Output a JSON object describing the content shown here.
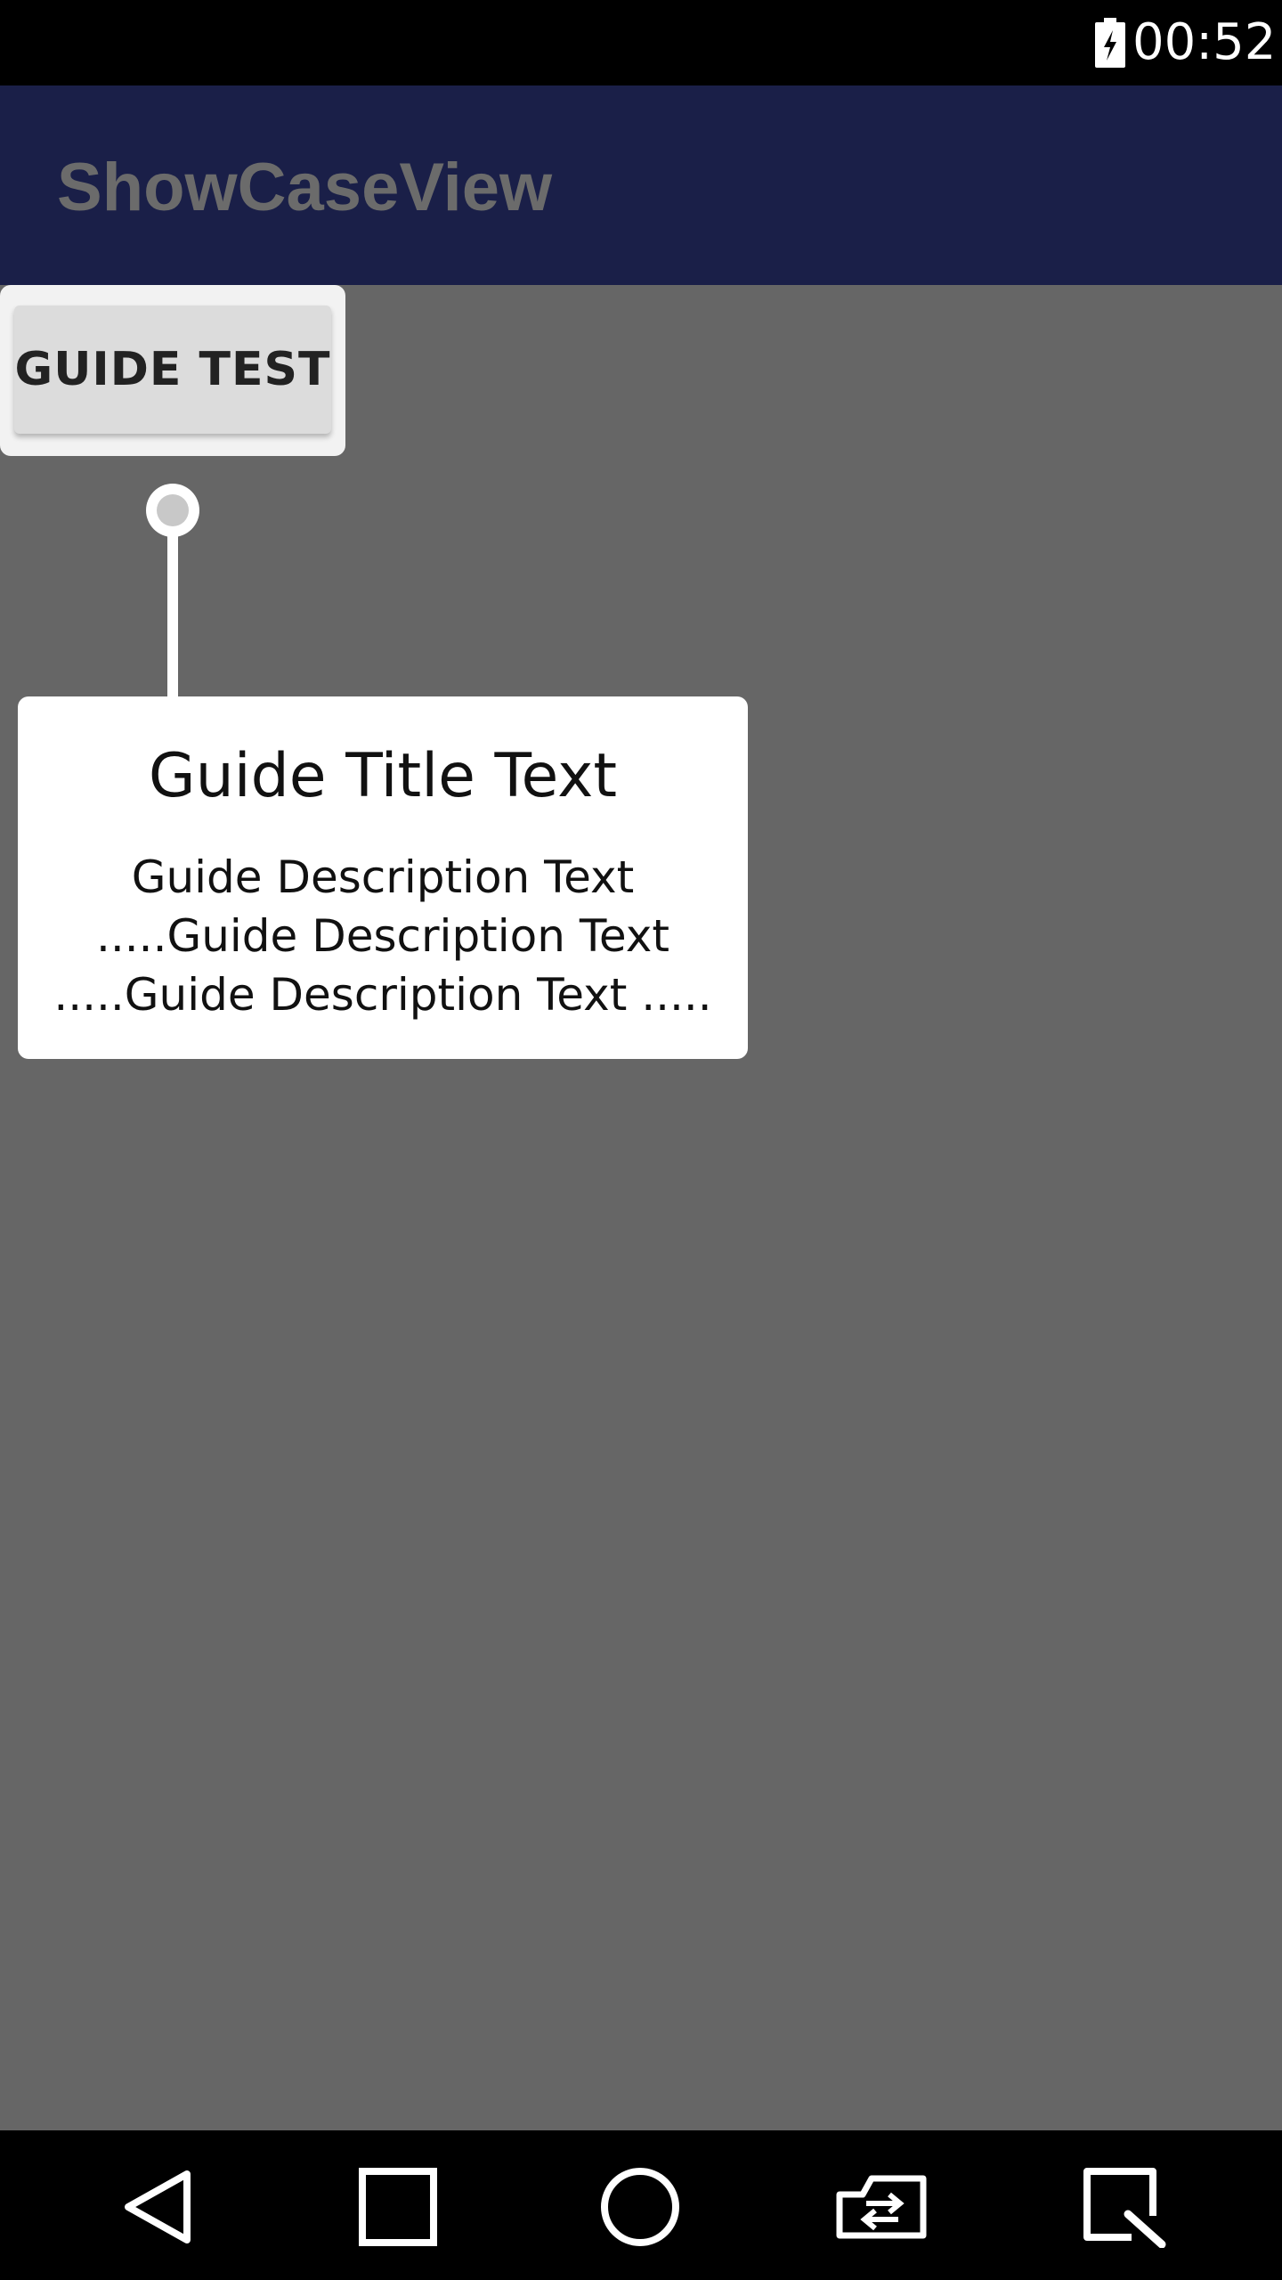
{
  "status_bar": {
    "time": "00:52",
    "icons": [
      "battery-charging-icon"
    ]
  },
  "app_bar": {
    "title": "ShowCaseView"
  },
  "main": {
    "guide_button_label": "GUIDE TEST"
  },
  "showcase": {
    "title": "Guide Title Text",
    "description_lines": [
      "Guide Description Text",
      ".....Guide Description Text",
      ".....Guide Description Text ....."
    ]
  },
  "nav_bar": {
    "icons": [
      "back-icon",
      "recents-icon",
      "home-icon",
      "screen-rotate-icon",
      "screenshot-icon"
    ]
  },
  "colors": {
    "status_bar_bg": "#000000",
    "app_bar_bg": "#1a1f48",
    "overlay_bg": "#666666",
    "card_bg": "#ffffff",
    "button_bg": "#dcdcdc"
  }
}
